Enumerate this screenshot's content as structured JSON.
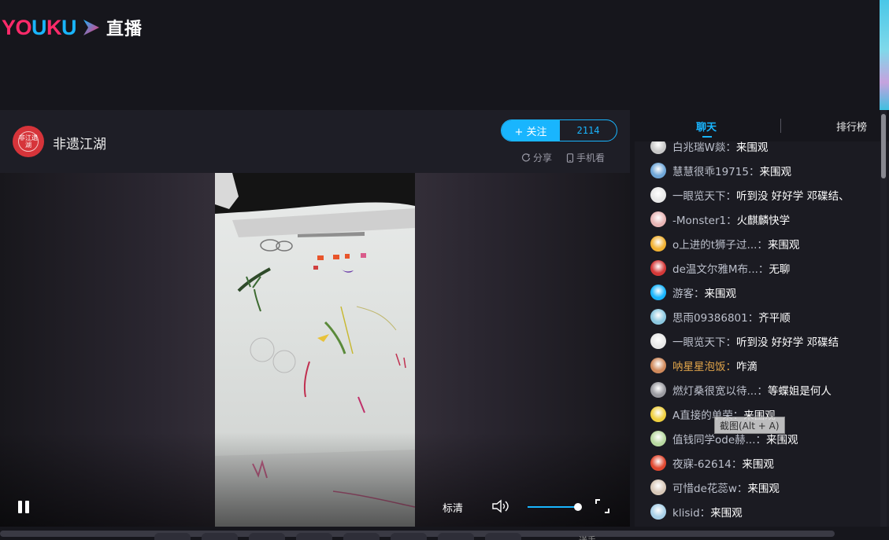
{
  "header": {
    "logo_text": "YOUKU",
    "logo_suffix": "直播"
  },
  "channel": {
    "avatar_text": "非江遗湖",
    "name": "非遗江湖",
    "follow_label": "+ 关注",
    "follower_count": "2114",
    "share_label": "分享",
    "mobile_label": "手机看"
  },
  "player": {
    "quality_label": "标清",
    "volume_level": 0.92
  },
  "chat": {
    "tabs": [
      {
        "label": "聊天",
        "active": true
      },
      {
        "label": "排行榜",
        "active": false
      }
    ],
    "messages": [
      {
        "user": "白兆瑞W燚：",
        "text": "来围观",
        "avatar_color": "#c8c8c8"
      },
      {
        "user": "慧慧很乖19715：",
        "text": "来围观",
        "avatar_color": "#6fa6d8"
      },
      {
        "user": "一眼览天下：",
        "text": "听到没 好好学 邓碟结、",
        "avatar_color": "#e8e8e8"
      },
      {
        "user": "-Monster1：",
        "text": "火麒麟快学",
        "avatar_color": "#e8b5b5"
      },
      {
        "user": "o上进的t狮子过...：",
        "text": "来围观",
        "avatar_color": "#f2b233"
      },
      {
        "user": "de温文尔雅M布...：",
        "text": "无聊",
        "avatar_color": "#d43838"
      },
      {
        "user": "游客：",
        "text": "来围观",
        "avatar_color": "#19b5fe"
      },
      {
        "user": "思雨09386801：",
        "text": "齐平顺",
        "avatar_color": "#8cc8e0"
      },
      {
        "user": "一眼览天下：",
        "text": "听到没 好好学 邓碟结",
        "avatar_color": "#e8e8e8"
      },
      {
        "user": "呐星星泡饭：",
        "text": "咋滴",
        "avatar_color": "#d08a5c",
        "gold": true
      },
      {
        "user": "燃灯桑很宽以待...：",
        "text": "等蝶姐是何人",
        "avatar_color": "#9a9aa0"
      },
      {
        "user": "A直接的单荣：",
        "text": "来围观",
        "avatar_color": "#f0d040"
      },
      {
        "user": "值钱同学ode赫...：",
        "text": "来围观",
        "avatar_color": "#b8d8a0"
      },
      {
        "user": "夜寐-62614：",
        "text": "来围观",
        "avatar_color": "#e04830"
      },
      {
        "user": "可惜de花蕊w：",
        "text": "来围观",
        "avatar_color": "#d8c8b8"
      },
      {
        "user": "klisid：",
        "text": "来围观",
        "avatar_color": "#a8d0e8"
      }
    ]
  },
  "tooltip": {
    "text": "截图(Alt + A)"
  },
  "gift_bar": {
    "text": "送手"
  }
}
